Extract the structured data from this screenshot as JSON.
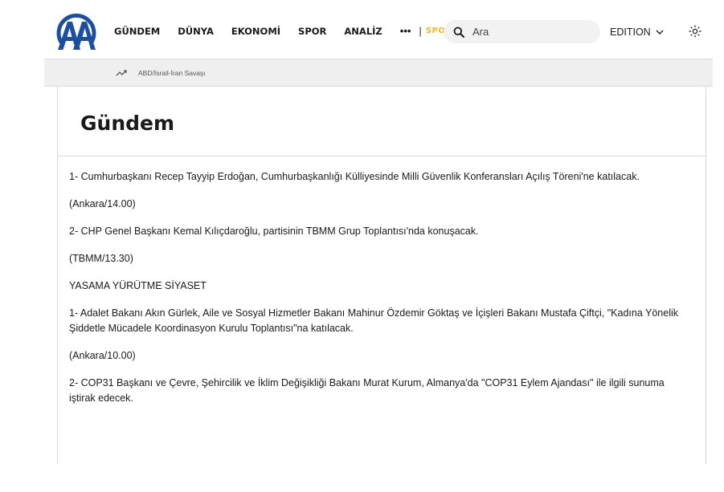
{
  "header": {
    "logo_text": "AA",
    "nav": [
      "GÜNDEM",
      "DÜNYA",
      "EKONOMİ",
      "SPOR",
      "ANALİZ"
    ],
    "more": "•••",
    "separator": "|",
    "spot": "SPOT!",
    "search_placeholder": "Ara",
    "edition_label": "EDITION"
  },
  "topic_bar": {
    "link": "ABD/İsrail-İran Savaşı"
  },
  "page": {
    "title": "Gündem",
    "paragraphs": [
      "1- Cumhurbaşkanı Recep Tayyip Erdoğan, Cumhurbaşkanlığı Külliyesinde Milli Güvenlik Konferansları Açılış Töreni'ne katılacak.",
      "(Ankara/14.00)",
      "2- CHP Genel Başkanı Kemal Kılıçdaroğlu, partisinin TBMM Grup Toplantısı'nda konuşacak.",
      "(TBMM/13.30)",
      "YASAMA YÜRÜTME SİYASET",
      "1- Adalet Bakanı Akın Gürlek, Aile ve Sosyal Hizmetler Bakanı Mahinur Özdemir Göktaş ve İçişleri Bakanı Mustafa Çiftçi, \"Kadına Yönelik Şiddetle Mücadele Koordinasyon Kurulu Toplantısı\"na katılacak.",
      "(Ankara/10.00)",
      "2- COP31 Başkanı ve Çevre, Şehircilik ve İklim Değişikliği Bakanı Murat Kurum, Almanya'da \"COP31 Eylem Ajandası\" ile ilgili sunuma iştirak edecek."
    ]
  },
  "colors": {
    "logo_blue": "#1c4fa0",
    "spot_yellow": "#f3b81f",
    "topic_bar_bg": "#efefef",
    "border": "#d9d9d9"
  },
  "icons": {
    "search": "search-icon",
    "edition_chevron": "chevron-down-icon",
    "theme_toggle": "sun-icon",
    "trending": "trending-up-icon"
  }
}
